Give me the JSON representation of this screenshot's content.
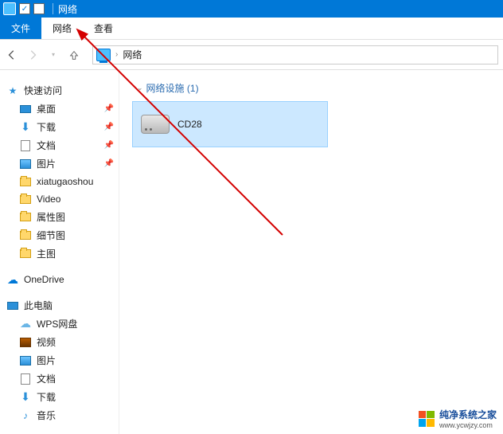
{
  "titlebar": {
    "title": "网络"
  },
  "ribbon": {
    "file": "文件",
    "network": "网络",
    "view": "查看"
  },
  "address": {
    "location": "网络"
  },
  "sidebar": {
    "quickaccess": {
      "label": "快速访问",
      "items": [
        {
          "label": "桌面",
          "pinned": true
        },
        {
          "label": "下载",
          "pinned": true
        },
        {
          "label": "文档",
          "pinned": true
        },
        {
          "label": "图片",
          "pinned": true
        },
        {
          "label": "xiatugaoshou",
          "pinned": false
        },
        {
          "label": "Video",
          "pinned": false
        },
        {
          "label": "属性图",
          "pinned": false
        },
        {
          "label": "细节图",
          "pinned": false
        },
        {
          "label": "主图",
          "pinned": false
        }
      ]
    },
    "onedrive": {
      "label": "OneDrive"
    },
    "thispc": {
      "label": "此电脑",
      "items": [
        {
          "label": "WPS网盘"
        },
        {
          "label": "视频"
        },
        {
          "label": "图片"
        },
        {
          "label": "文档"
        },
        {
          "label": "下载"
        },
        {
          "label": "音乐"
        }
      ]
    }
  },
  "content": {
    "section": {
      "label": "网络设施",
      "count": 1
    },
    "device": {
      "name": "CD28"
    }
  },
  "watermark": {
    "line1": "纯净系统之家",
    "line2": "www.ycwjzy.com"
  }
}
